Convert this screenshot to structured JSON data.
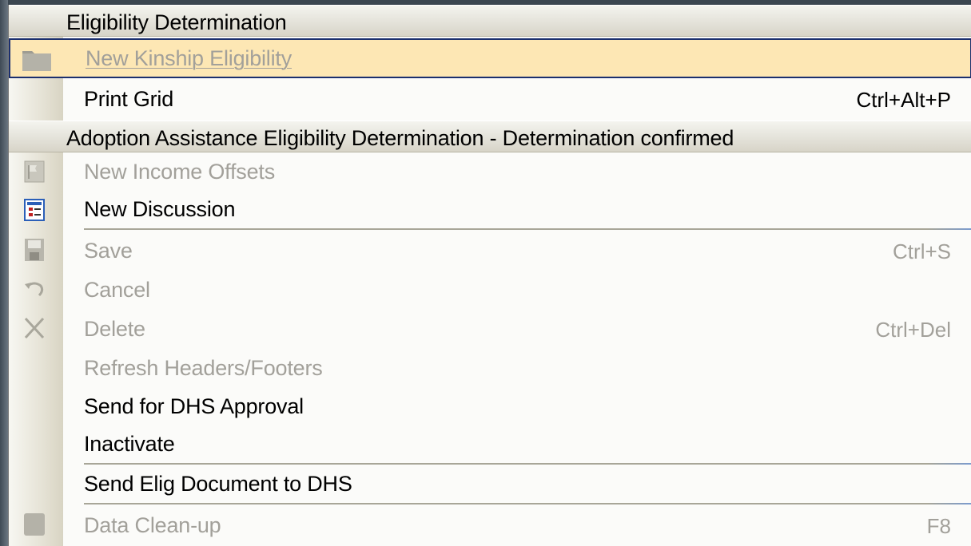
{
  "menu": {
    "sections": [
      {
        "header": "Eligibility Determination",
        "items": [
          {
            "label": "New Kinship Eligibility",
            "shortcut": "",
            "enabled": false,
            "icon": "folder-icon",
            "highlighted": true
          },
          {
            "label": "Print Grid",
            "shortcut": "Ctrl+Alt+P",
            "enabled": true,
            "icon": "",
            "highlighted": false
          }
        ]
      },
      {
        "header": "Adoption Assistance Eligibility Determination - Determination confirmed",
        "items": [
          {
            "label": "New Income Offsets",
            "shortcut": "",
            "enabled": false,
            "icon": "flag-icon"
          },
          {
            "label": "New Discussion",
            "shortcut": "",
            "enabled": true,
            "icon": "discussion-icon"
          },
          {
            "label": "Save",
            "shortcut": "Ctrl+S",
            "enabled": false,
            "icon": "floppy-disk-icon"
          },
          {
            "label": "Cancel",
            "shortcut": "",
            "enabled": false,
            "icon": "undo-icon"
          },
          {
            "label": "Delete",
            "shortcut": "Ctrl+Del",
            "enabled": false,
            "icon": "delete-x-icon"
          },
          {
            "label": "Refresh Headers/Footers",
            "shortcut": "",
            "enabled": false,
            "icon": ""
          },
          {
            "label": "Send for DHS Approval",
            "shortcut": "",
            "enabled": true,
            "icon": ""
          },
          {
            "label": "Inactivate",
            "shortcut": "",
            "enabled": true,
            "icon": ""
          },
          {
            "label": "Send Elig Document to DHS",
            "shortcut": "",
            "enabled": true,
            "icon": ""
          },
          {
            "label": "Data Clean-up",
            "shortcut": "F8",
            "enabled": false,
            "icon": "square-icon"
          }
        ]
      }
    ]
  },
  "colors": {
    "highlight_bg": "#fde7b4",
    "highlight_border": "#1b2f6e",
    "disabled_text": "#a2a09a"
  }
}
